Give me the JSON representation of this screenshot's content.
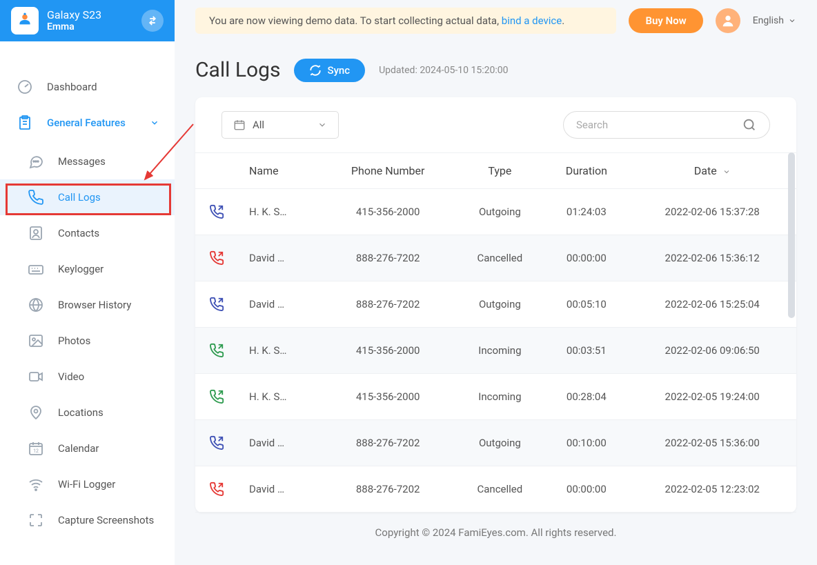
{
  "header": {
    "device": "Galaxy S23",
    "user": "Emma"
  },
  "sidebar": {
    "dashboard": "Dashboard",
    "general_features": "General Features",
    "items": [
      "Messages",
      "Call Logs",
      "Contacts",
      "Keylogger",
      "Browser History",
      "Photos",
      "Video",
      "Locations",
      "Calendar",
      "Wi-Fi Logger",
      "Capture Screenshots"
    ],
    "active_index": 1
  },
  "topbar": {
    "demo_prefix": "You are now viewing demo data. To start collecting actual data, ",
    "demo_link": "bind a device",
    "demo_suffix": ".",
    "buy_label": "Buy Now",
    "language": "English"
  },
  "page": {
    "title": "Call Logs",
    "sync_label": "Sync",
    "updated_prefix": "Updated: ",
    "updated_time": "2024-05-10 15:20:00"
  },
  "filter": {
    "value": "All"
  },
  "search": {
    "placeholder": "Search"
  },
  "table": {
    "columns": [
      "Name",
      "Phone Number",
      "Type",
      "Duration",
      "Date"
    ],
    "rows": [
      {
        "icon": "outgoing",
        "name": "H. K. S…",
        "phone": "415-356-2000",
        "type": "Outgoing",
        "duration": "01:24:03",
        "date": "2022-02-06 15:37:28"
      },
      {
        "icon": "cancelled",
        "name": "David …",
        "phone": "888-276-7202",
        "type": "Cancelled",
        "duration": "00:00:00",
        "date": "2022-02-06 15:36:12"
      },
      {
        "icon": "outgoing",
        "name": "David …",
        "phone": "888-276-7202",
        "type": "Outgoing",
        "duration": "00:05:10",
        "date": "2022-02-06 15:25:04"
      },
      {
        "icon": "incoming",
        "name": "H. K. S…",
        "phone": "415-356-2000",
        "type": "Incoming",
        "duration": "00:03:51",
        "date": "2022-02-06 09:06:50"
      },
      {
        "icon": "incoming",
        "name": "H. K. S…",
        "phone": "415-356-2000",
        "type": "Incoming",
        "duration": "00:28:04",
        "date": "2022-02-05 19:24:00"
      },
      {
        "icon": "outgoing",
        "name": "David …",
        "phone": "888-276-7202",
        "type": "Outgoing",
        "duration": "00:10:00",
        "date": "2022-02-05 15:36:00"
      },
      {
        "icon": "cancelled",
        "name": "David …",
        "phone": "888-276-7202",
        "type": "Cancelled",
        "duration": "00:00:00",
        "date": "2022-02-05 12:23:02"
      }
    ]
  },
  "footer": "Copyright © 2024 FamiEyes.com. All rights reserved."
}
